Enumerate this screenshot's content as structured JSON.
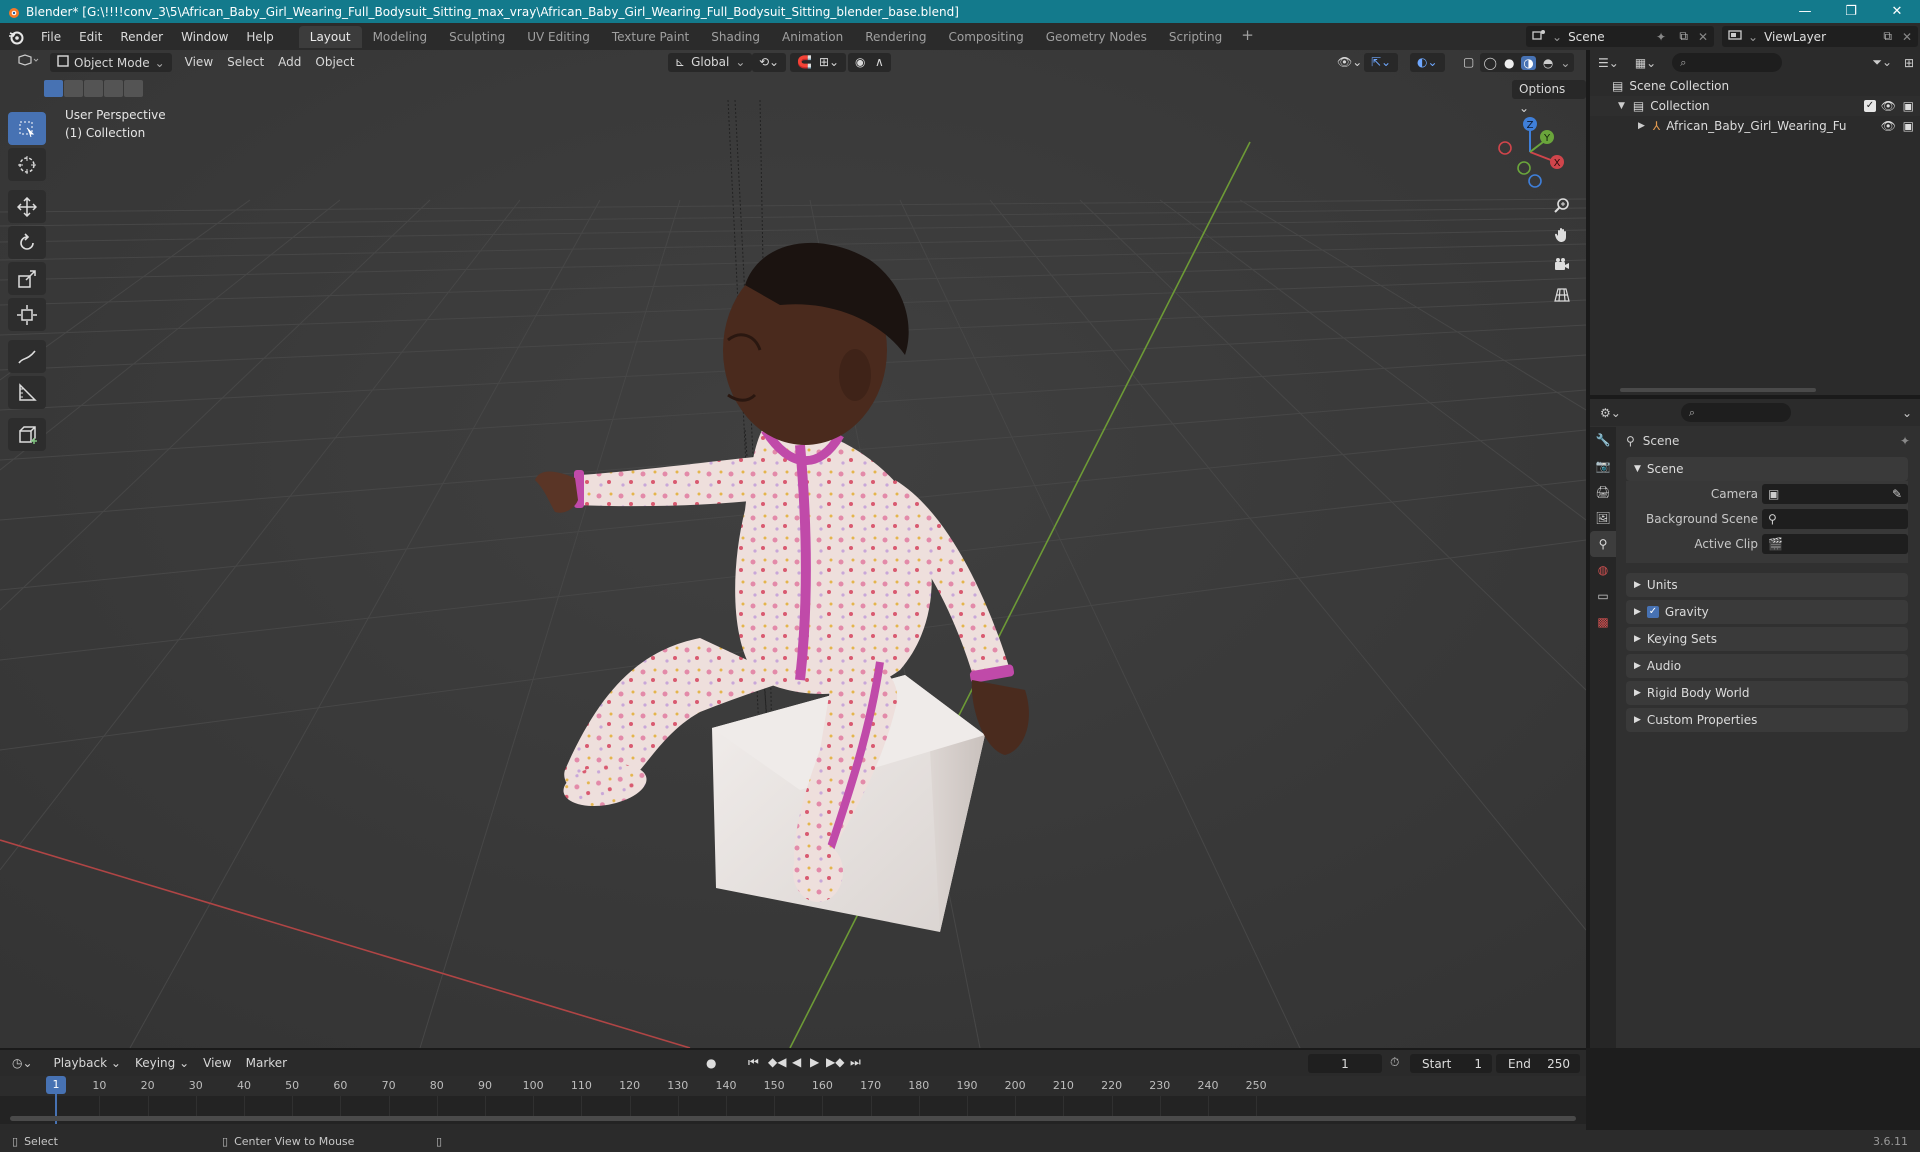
{
  "window": {
    "title": "Blender* [G:\\!!!!conv_3\\5\\African_Baby_Girl_Wearing_Full_Bodysuit_Sitting_max_vray\\African_Baby_Girl_Wearing_Full_Bodysuit_Sitting_blender_base.blend]",
    "controls": {
      "minimize": "—",
      "maximize": "❐",
      "close": "✕"
    }
  },
  "menus": [
    "File",
    "Edit",
    "Render",
    "Window",
    "Help"
  ],
  "workspaces": [
    "Layout",
    "Modeling",
    "Sculpting",
    "UV Editing",
    "Texture Paint",
    "Shading",
    "Animation",
    "Rendering",
    "Compositing",
    "Geometry Nodes",
    "Scripting"
  ],
  "workspace_add": "+",
  "scene_selector": {
    "value": "Scene"
  },
  "view_layer": {
    "value": "ViewLayer"
  },
  "viewport": {
    "mode": "Object Mode",
    "menus": [
      "View",
      "Select",
      "Add",
      "Object"
    ],
    "transform_orientation": "Global",
    "options_label": "Options",
    "overlay_line1": "User Perspective",
    "overlay_line2": "(1) Collection",
    "gizmo_axes": {
      "x": "X",
      "y": "Y",
      "z": "Z"
    }
  },
  "outliner": {
    "rows": [
      {
        "label": "Scene Collection"
      },
      {
        "label": "Collection"
      },
      {
        "label": "African_Baby_Girl_Wearing_Full_Bo"
      }
    ]
  },
  "properties": {
    "context_label": "Scene",
    "section_scene": "Scene",
    "fields": [
      {
        "label": "Camera"
      },
      {
        "label": "Background Scene"
      },
      {
        "label": "Active Clip"
      }
    ],
    "panels": [
      "Units",
      "Gravity",
      "Keying Sets",
      "Audio",
      "Rigid Body World",
      "Custom Properties"
    ]
  },
  "timeline": {
    "menus": [
      "Playback",
      "Keying",
      "View",
      "Marker"
    ],
    "current_frame": "1",
    "start_label": "Start",
    "start_value": "1",
    "end_label": "End",
    "end_value": "250",
    "ruler_ticks": [
      "10",
      "20",
      "30",
      "40",
      "50",
      "60",
      "70",
      "80",
      "90",
      "100",
      "110",
      "120",
      "130",
      "140",
      "150",
      "160",
      "170",
      "180",
      "190",
      "200",
      "210",
      "220",
      "230",
      "240",
      "250"
    ],
    "playhead_label": "1"
  },
  "statusbar": {
    "select_label": "Select",
    "center_label": "Center View to Mouse",
    "version": "3.6.11"
  }
}
